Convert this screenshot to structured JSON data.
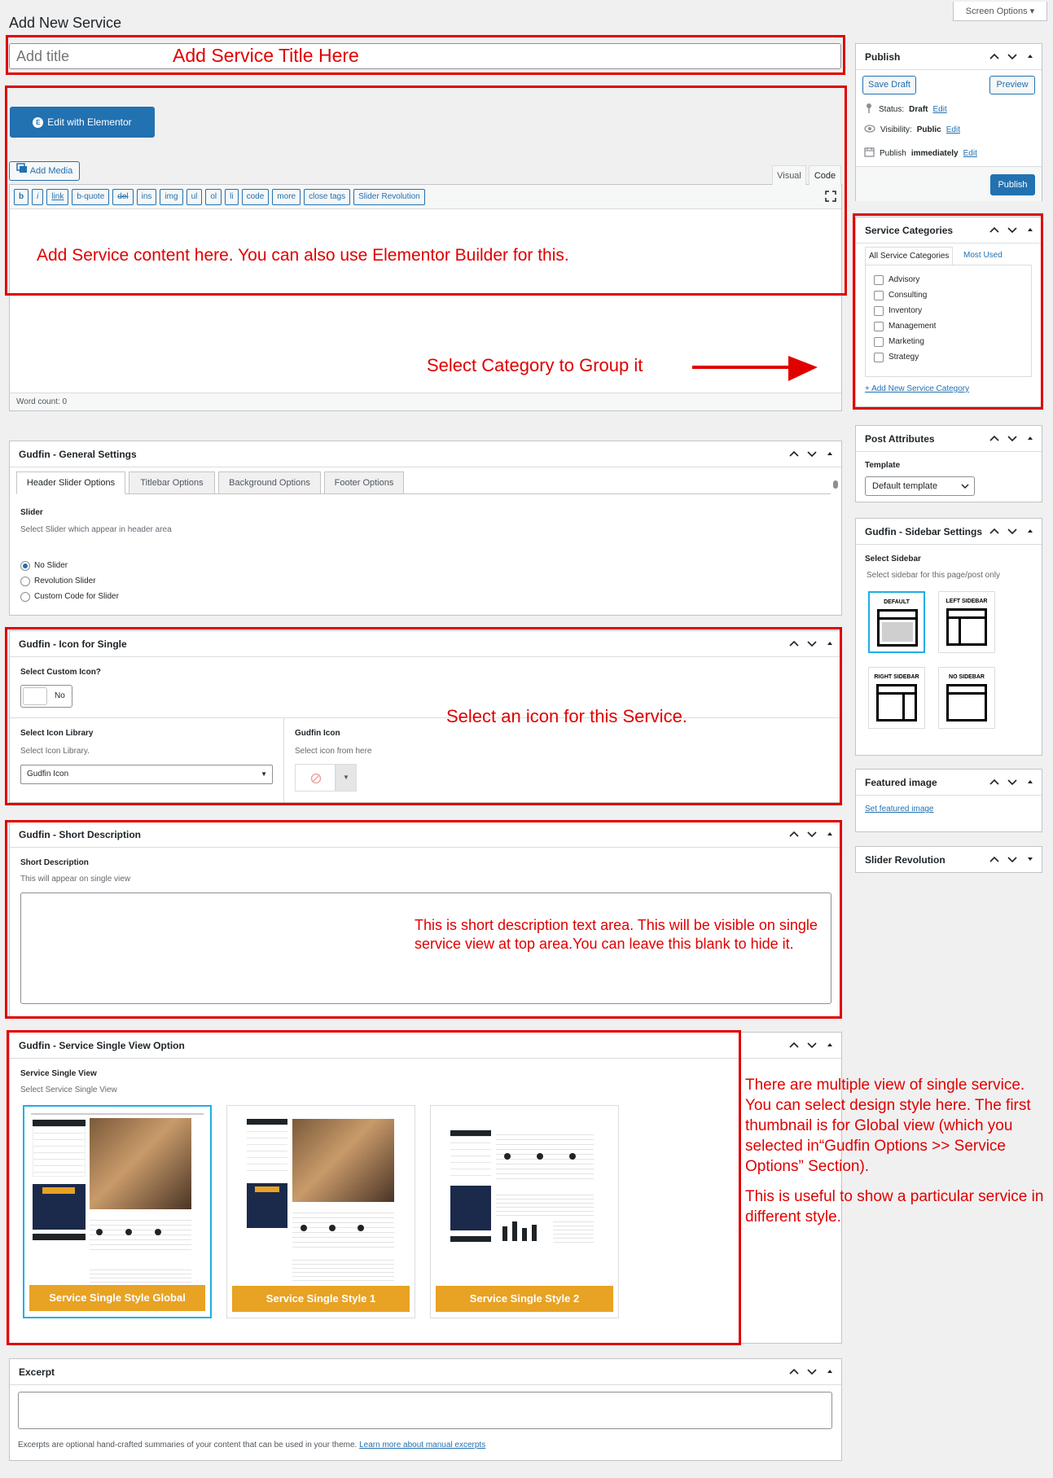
{
  "page_title": "Add New Service",
  "screen_options": "Screen Options",
  "title_input": {
    "placeholder": "Add title"
  },
  "editor": {
    "elementor_button": "Edit with Elementor",
    "add_media": "Add Media",
    "tabs": [
      "Visual",
      "Code"
    ],
    "quicktags": [
      "b",
      "i",
      "link",
      "b-quote",
      "del",
      "ins",
      "img",
      "ul",
      "ol",
      "li",
      "code",
      "more",
      "close tags",
      "Slider Revolution"
    ],
    "word_count": "Word count: 0"
  },
  "publish": {
    "title": "Publish",
    "save_draft": "Save Draft",
    "preview": "Preview",
    "status_label": "Status:",
    "status_value": "Draft",
    "visibility_label": "Visibility:",
    "visibility_value": "Public",
    "publish_label": "Publish",
    "publish_value": "immediately",
    "edit": "Edit",
    "publish_button": "Publish"
  },
  "categories": {
    "title": "Service Categories",
    "tab_all": "All Service Categories",
    "tab_most_used": "Most Used",
    "items": [
      "Advisory",
      "Consulting",
      "Inventory",
      "Management",
      "Marketing",
      "Strategy"
    ],
    "add_new": "+ Add New Service Category"
  },
  "post_attributes": {
    "title": "Post Attributes",
    "template_label": "Template",
    "template_value": "Default template"
  },
  "sidebar_settings": {
    "title": "Gudfin - Sidebar Settings",
    "label": "Select Sidebar",
    "hint": "Select sidebar for this page/post only",
    "options": [
      "DEFAULT",
      "LEFT SIDEBAR",
      "RIGHT SIDEBAR",
      "NO SIDEBAR"
    ]
  },
  "featured_image": {
    "title": "Featured image",
    "link": "Set featured image"
  },
  "slider_revolution": {
    "title": "Slider Revolution"
  },
  "general_settings": {
    "title": "Gudfin - General Settings",
    "tabs": [
      "Header Slider Options",
      "Titlebar Options",
      "Background Options",
      "Footer Options"
    ],
    "slider_label": "Slider",
    "slider_hint": "Select Slider which appear in header area",
    "radios": [
      "No Slider",
      "Revolution Slider",
      "Custom Code for Slider"
    ]
  },
  "icon_single": {
    "title": "Gudfin - Icon for Single",
    "custom_label": "Select Custom Icon?",
    "toggle_value": "No",
    "library_label": "Select Icon Library",
    "library_hint": "Select Icon Library.",
    "library_value": "Gudfin Icon",
    "icon_label": "Gudfin Icon",
    "icon_hint": "Select icon from here"
  },
  "short_description": {
    "title": "Gudfin - Short Description",
    "label": "Short Description",
    "hint": "This will appear on single view"
  },
  "single_view": {
    "title": "Gudfin - Service Single View Option",
    "label": "Service Single View",
    "hint": "Select Service Single View",
    "thumbs": [
      "Service Single  Style Global",
      "Service Single  Style 1",
      "Service Single  Style 2"
    ]
  },
  "excerpt": {
    "title": "Excerpt",
    "help": "Excerpts are optional hand-crafted summaries of your content that can be used in your theme.",
    "help_link": "Learn more about manual excerpts"
  },
  "annotations": {
    "title": "Add Service Title Here",
    "content": "Add Service content here. You can also use Elementor Builder for this.",
    "category": "Select Category to Group it",
    "icon": "Select an icon for this Service.",
    "short_desc": "This is short description text area. This will be visible on single service view at top area.You can leave this blank to hide it.",
    "view_1": "There are multiple view of single service. You can select design style here. The first thumbnail is for Global view (which you selected in“Gudfin Options >> Service Options” Section).",
    "view_2": "This is useful to show a particular service in different style."
  },
  "colors": {
    "accent": "#2271b1",
    "annotation": "#e00000",
    "thumb_bar": "#e8a224",
    "selected_border": "#1eaee5"
  },
  "icons": [
    "chevron-up-icon",
    "chevron-down-icon",
    "triangle-up-icon",
    "pin-icon",
    "eye-icon",
    "calendar-icon",
    "add-media-icon",
    "fullscreen-icon",
    "elementor-icon",
    "no-entry-icon"
  ]
}
